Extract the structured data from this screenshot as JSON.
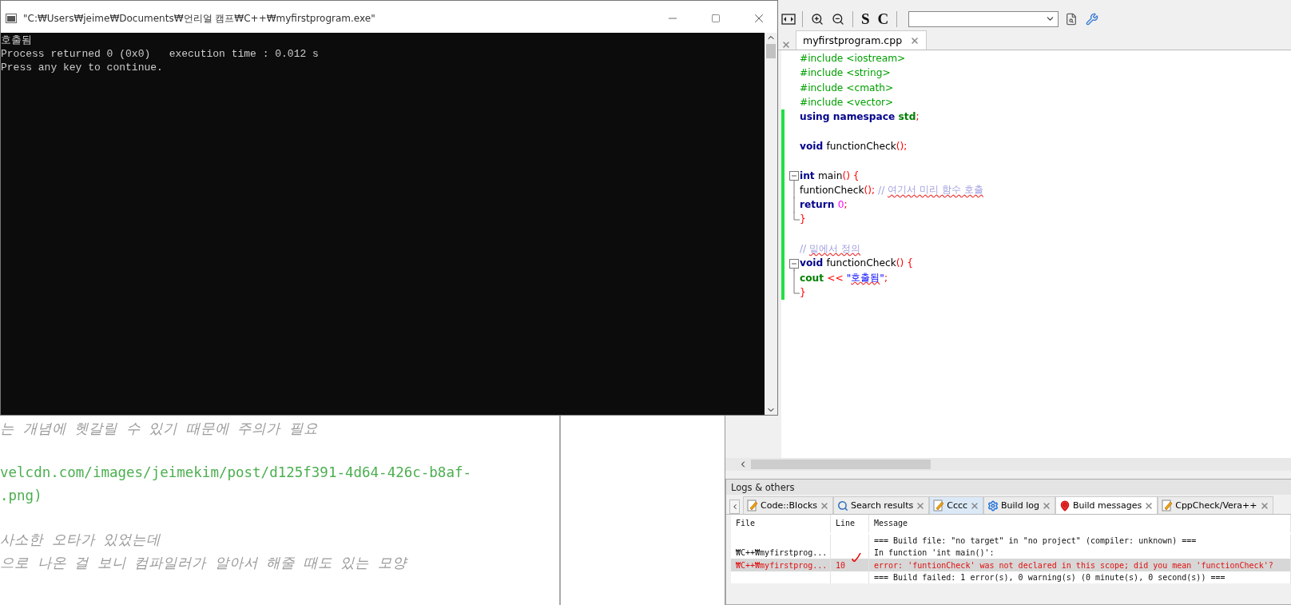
{
  "console": {
    "title": "\"C:₩Users₩jeime₩Documents₩언리얼 캠프₩C++₩myfirstprogram.exe\"",
    "lines": [
      "호출됨",
      "Process returned 0 (0x0)   execution time : 0.012 s",
      "Press any key to continue."
    ]
  },
  "notes": {
    "paragraphs": [
      {
        "kind": "note",
        "lines": [
          "는 개념에 헷갈릴 수 있기 때문에 주의가 필요"
        ]
      },
      {
        "kind": "link",
        "lines": [
          "velcdn.com/images/jeimekim/post/d125f391-4d64-426c-b8af-",
          ".png)"
        ]
      },
      {
        "kind": "note",
        "lines": [
          "사소한 오타가 있었는데",
          "으로 나온 걸 보니 컴파일러가 알아서 해줄 때도 있는 모양"
        ]
      }
    ]
  },
  "editor": {
    "toolbar": {
      "letter_buttons": [
        "S",
        "C"
      ]
    },
    "tab": {
      "label": "myfirstprogram.cpp",
      "selected": true
    },
    "lines": [
      {
        "kind": "plain",
        "changed": false,
        "tokens": [
          {
            "kind": "preproc",
            "text": "#include <iostream>"
          }
        ]
      },
      {
        "kind": "plain",
        "changed": false,
        "tokens": [
          {
            "kind": "preproc",
            "text": "#include <string>"
          }
        ]
      },
      {
        "kind": "plain",
        "changed": false,
        "tokens": [
          {
            "kind": "preproc",
            "text": "#include <cmath>"
          }
        ]
      },
      {
        "kind": "plain",
        "changed": false,
        "tokens": [
          {
            "kind": "preproc",
            "text": "#include <vector>"
          }
        ]
      },
      {
        "kind": "plain",
        "changed": true,
        "tokens": [
          {
            "kind": "keyword",
            "text": "using namespace "
          },
          {
            "kind": "name",
            "text": "std"
          },
          {
            "kind": "punct",
            "text": ";"
          }
        ]
      },
      {
        "kind": "plain",
        "changed": true
      },
      {
        "kind": "plain",
        "changed": true,
        "tokens": [
          {
            "kind": "keyword",
            "text": "void "
          },
          {
            "kind": "plain",
            "text": "functionCheck"
          },
          {
            "kind": "punct",
            "text": "();"
          }
        ]
      },
      {
        "kind": "plain",
        "changed": true
      },
      {
        "kind": "fold_start",
        "changed": true,
        "tokens": [
          {
            "kind": "keyword",
            "text": "int "
          },
          {
            "kind": "plain",
            "text": "main"
          },
          {
            "kind": "punct",
            "text": "() {"
          }
        ]
      },
      {
        "kind": "fold_body",
        "changed": true,
        "tokens": [
          {
            "kind": "plain",
            "text": "funtionCheck"
          },
          {
            "kind": "punct",
            "text": "(); "
          },
          {
            "kind": "comment",
            "text": "// "
          },
          {
            "kind": "comment",
            "text": "여기서 미리 함수 호출",
            "spell_error": true
          }
        ]
      },
      {
        "kind": "fold_body",
        "changed": true,
        "tokens": [
          {
            "kind": "keyword",
            "text": "return "
          },
          {
            "kind": "number",
            "text": "0"
          },
          {
            "kind": "punct",
            "text": ";"
          }
        ]
      },
      {
        "kind": "fold_end",
        "changed": true,
        "tokens": [
          {
            "kind": "punct",
            "text": "}"
          }
        ]
      },
      {
        "kind": "plain",
        "changed": true
      },
      {
        "kind": "plain",
        "changed": true,
        "tokens": [
          {
            "kind": "comment",
            "text": "// "
          },
          {
            "kind": "comment",
            "text": "밑에서 정의",
            "spell_error": true
          }
        ]
      },
      {
        "kind": "fold_start",
        "changed": true,
        "tokens": [
          {
            "kind": "keyword",
            "text": "void "
          },
          {
            "kind": "plain",
            "text": "functionCheck"
          },
          {
            "kind": "punct",
            "text": "() {"
          }
        ]
      },
      {
        "kind": "fold_body",
        "changed": true,
        "tokens": [
          {
            "kind": "name",
            "text": "cout "
          },
          {
            "kind": "punct",
            "text": "<< "
          },
          {
            "kind": "string",
            "text": "\""
          },
          {
            "kind": "string",
            "text": "호출됨",
            "spell_error": true
          },
          {
            "kind": "string",
            "text": "\""
          },
          {
            "kind": "punct",
            "text": ";"
          }
        ]
      },
      {
        "kind": "fold_end",
        "changed": true,
        "tokens": [
          {
            "kind": "punct",
            "text": "}"
          }
        ]
      }
    ]
  },
  "logs": {
    "title": "Logs & others",
    "tabs": [
      {
        "label": "Code::Blocks",
        "kind": "note",
        "selected": false,
        "hovered": false
      },
      {
        "label": "Search results",
        "kind": "search",
        "selected": false,
        "hovered": false
      },
      {
        "label": "Cccc",
        "kind": "note",
        "selected": false,
        "hovered": true
      },
      {
        "label": "Build log",
        "kind": "gear",
        "selected": false,
        "hovered": false
      },
      {
        "label": "Build messages",
        "kind": "pin",
        "selected": true,
        "hovered": false
      },
      {
        "label": "CppCheck/Vera++",
        "kind": "note",
        "selected": false,
        "hovered": false
      }
    ],
    "columns": [
      "File",
      "Line",
      "Message"
    ],
    "rows": [
      {
        "kind": "info",
        "selected": false,
        "message": "=== Build file: \"no target\" in \"no project\" (compiler: unknown) ==="
      },
      {
        "kind": "info",
        "selected": false,
        "file": "₩C++₩myfirstprog...",
        "message": "In function 'int main()':"
      },
      {
        "kind": "error",
        "selected": true,
        "file": "₩C++₩myfirstprog...",
        "line": "10",
        "message": "error: 'funtionCheck' was not declared in this scope; did you mean 'functionCheck'?"
      },
      {
        "kind": "info",
        "selected": false,
        "message": "=== Build failed: 1 error(s), 0 warning(s) (0 minute(s), 0 second(s)) ==="
      }
    ]
  }
}
